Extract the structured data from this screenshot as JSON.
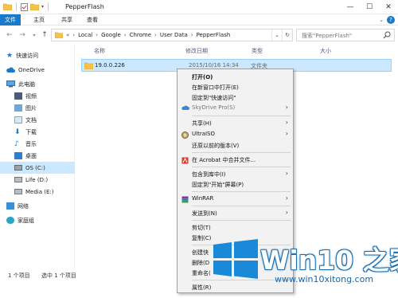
{
  "window": {
    "title": "PepperFlash"
  },
  "ribbon": {
    "tabs": [
      "文件",
      "主页",
      "共享",
      "查看"
    ]
  },
  "address": {
    "overflow": "«",
    "crumbs": [
      "Local",
      "Google",
      "Chrome",
      "User Data",
      "PepperFlash"
    ]
  },
  "search": {
    "placeholder": "搜索\"PepperFlash\""
  },
  "nav": {
    "items": [
      {
        "label": "快速访问",
        "icon": "star-icon"
      },
      {
        "label": "OneDrive",
        "icon": "cloud-icon"
      },
      {
        "label": "此电脑",
        "icon": "computer-icon"
      },
      {
        "label": "视频",
        "icon": "video-folder-icon"
      },
      {
        "label": "图片",
        "icon": "pictures-folder-icon"
      },
      {
        "label": "文档",
        "icon": "documents-folder-icon"
      },
      {
        "label": "下载",
        "icon": "downloads-folder-icon"
      },
      {
        "label": "音乐",
        "icon": "music-folder-icon"
      },
      {
        "label": "桌面",
        "icon": "desktop-folder-icon"
      },
      {
        "label": "OS (C:)",
        "icon": "drive-icon"
      },
      {
        "label": "Life (D:)",
        "icon": "drive-icon"
      },
      {
        "label": "Media (E:)",
        "icon": "drive-icon"
      },
      {
        "label": "网络",
        "icon": "network-icon"
      },
      {
        "label": "家庭组",
        "icon": "homegroup-icon"
      }
    ]
  },
  "columns": {
    "name": "名称",
    "date": "修改日期",
    "type": "类型",
    "size": "大小"
  },
  "files": [
    {
      "name": "19.0.0.226",
      "date": "2015/10/16 14:34",
      "type": "文件夹",
      "icon": "folder-icon"
    }
  ],
  "context_menu": {
    "items": [
      {
        "label": "打开(O)",
        "bold": true
      },
      {
        "label": "在新窗口中打开(E)"
      },
      {
        "label": "固定到\"快速访问\""
      },
      {
        "label": "SkyDrive Pro(S)",
        "icon": "skydrive-icon",
        "submenu": true,
        "dim": true
      },
      {
        "label": "共享(H)",
        "submenu": true
      },
      {
        "label": "UltraISO",
        "icon": "ultraiso-icon",
        "submenu": true
      },
      {
        "label": "还原以前的版本(V)"
      },
      {
        "label": "在 Acrobat 中合并文件...",
        "icon": "acrobat-icon"
      },
      {
        "label": "包含到库中(I)",
        "submenu": true
      },
      {
        "label": "固定到\"开始\"屏幕(P)"
      },
      {
        "label": "WinRAR",
        "icon": "winrar-icon",
        "submenu": true
      },
      {
        "label": "发送到(N)",
        "submenu": true
      },
      {
        "label": "剪切(T)"
      },
      {
        "label": "复制(C)"
      },
      {
        "label": "创建快"
      },
      {
        "label": "删除(D"
      },
      {
        "label": "重命名("
      },
      {
        "label": "属性(R)"
      }
    ]
  },
  "status": {
    "count": "1 个项目",
    "selected": "选中 1 个项目"
  },
  "watermark": {
    "brand": "Win10 之家",
    "url": "www.win10xitong.com"
  },
  "colors": {
    "accent": "#1979ca",
    "selection": "#cce8ff",
    "selection_border": "#99d1ff",
    "menu_bg": "#f2f2f2"
  }
}
